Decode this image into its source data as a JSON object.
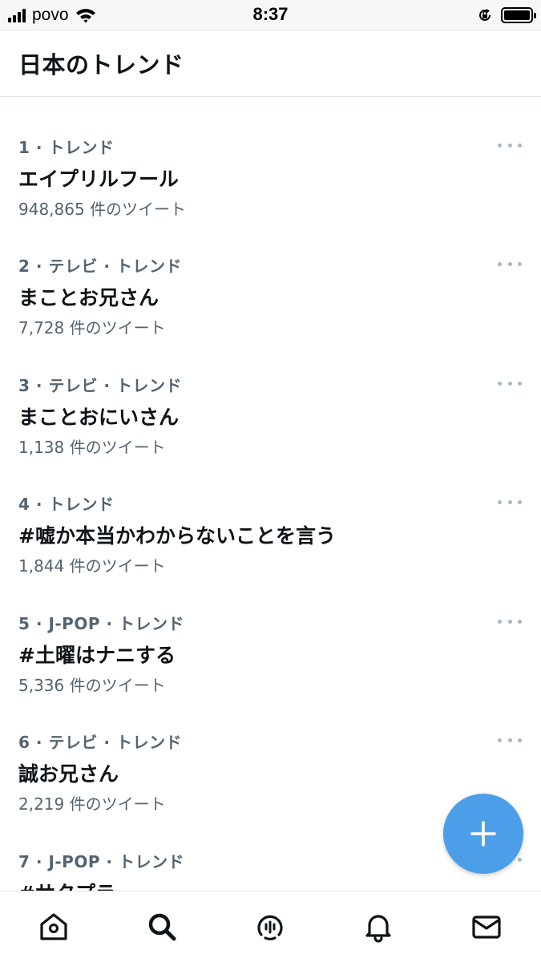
{
  "status_bar": {
    "carrier": "povo",
    "time": "8:37"
  },
  "header": {
    "title": "日本のトレンド"
  },
  "trends": [
    {
      "meta": "1 · トレンド",
      "name": "エイプリルフール",
      "count": "948,865 件のツイート"
    },
    {
      "meta": "2 · テレビ · トレンド",
      "name": "まことお兄さん",
      "count": "7,728 件のツイート"
    },
    {
      "meta": "3 · テレビ · トレンド",
      "name": "まことおにいさん",
      "count": "1,138 件のツイート"
    },
    {
      "meta": "4 · トレンド",
      "name": "#嘘か本当かわからないことを言う",
      "count": "1,844 件のツイート"
    },
    {
      "meta": "5 · J-POP · トレンド",
      "name": "#土曜はナニする",
      "count": "5,336 件のツイート"
    },
    {
      "meta": "6 · テレビ · トレンド",
      "name": "誠お兄さん",
      "count": "2,219 件のツイート"
    },
    {
      "meta": "7 · J-POP · トレンド",
      "name": "#サタプラ",
      "count": ""
    }
  ],
  "fab": {
    "icon": "plus-icon",
    "color": "#4a9fe8"
  },
  "tab_bar": {
    "tabs": [
      {
        "icon": "home-icon"
      },
      {
        "icon": "search-icon",
        "active": true
      },
      {
        "icon": "spaces-icon"
      },
      {
        "icon": "bell-icon"
      },
      {
        "icon": "mail-icon"
      }
    ]
  },
  "colors": {
    "text_primary": "#0f1419",
    "text_secondary": "#536471",
    "accent": "#4a9fe8"
  }
}
